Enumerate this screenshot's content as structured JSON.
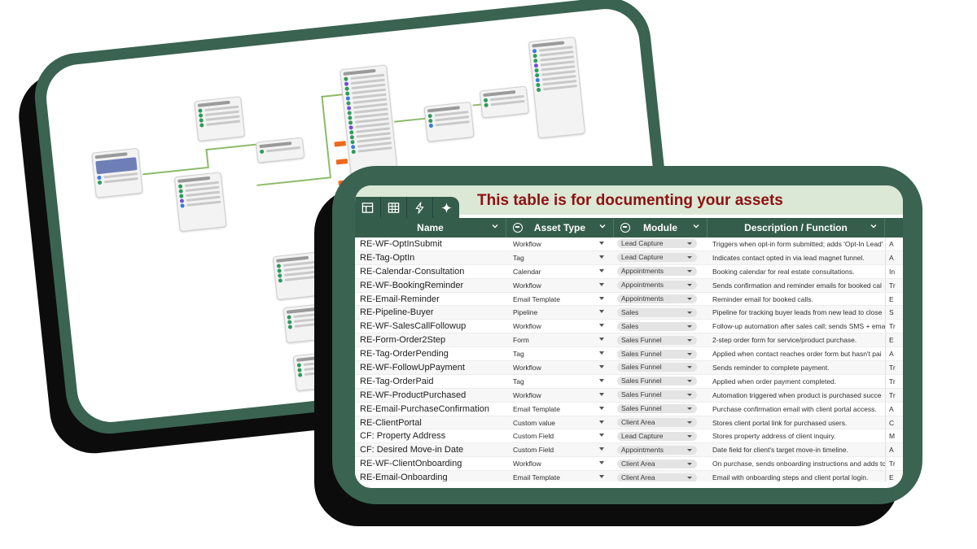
{
  "table": {
    "title": "This table is for documenting your assets",
    "columns": {
      "name": "Name",
      "asset_type": "Asset Type",
      "module": "Module",
      "description": "Description / Function"
    },
    "rows": [
      {
        "name": "RE-WF-OptInSubmit",
        "type": "Workflow",
        "module": "Lead Capture",
        "desc": "Triggers when opt-in form submitted; adds 'Opt-In Lead'",
        "extra": "A"
      },
      {
        "name": "RE-Tag-OptIn",
        "type": "Tag",
        "module": "Lead Capture",
        "desc": "Indicates contact opted in via lead magnet funnel.",
        "extra": "A"
      },
      {
        "name": "RE-Calendar-Consultation",
        "type": "Calendar",
        "module": "Appointments",
        "desc": "Booking calendar for real estate consultations.",
        "extra": "In"
      },
      {
        "name": "RE-WF-BookingReminder",
        "type": "Workflow",
        "module": "Appointments",
        "desc": "Sends confirmation and reminder emails for booked cal",
        "extra": "Tr"
      },
      {
        "name": "RE-Email-Reminder",
        "type": "Email Template",
        "module": "Appointments",
        "desc": "Reminder email for booked calls.",
        "extra": "E"
      },
      {
        "name": "RE-Pipeline-Buyer",
        "type": "Pipeline",
        "module": "Sales",
        "desc": "Pipeline for tracking buyer leads from new lead to close",
        "extra": "S"
      },
      {
        "name": "RE-WF-SalesCallFollowup",
        "type": "Workflow",
        "module": "Sales",
        "desc": "Follow-up automation after sales call; sends SMS + ema",
        "extra": "Tr"
      },
      {
        "name": "RE-Form-Order2Step",
        "type": "Form",
        "module": "Sales Funnel",
        "desc": "2-step order form for service/product purchase.",
        "extra": "E"
      },
      {
        "name": "RE-Tag-OrderPending",
        "type": "Tag",
        "module": "Sales Funnel",
        "desc": "Applied when contact reaches order form but hasn't pai",
        "extra": "A"
      },
      {
        "name": "RE-WF-FollowUpPayment",
        "type": "Workflow",
        "module": "Sales Funnel",
        "desc": "Sends reminder to complete payment.",
        "extra": "Tr"
      },
      {
        "name": "RE-Tag-OrderPaid",
        "type": "Tag",
        "module": "Sales Funnel",
        "desc": "Applied when order payment completed.",
        "extra": "Tr"
      },
      {
        "name": "RE-WF-ProductPurchased",
        "type": "Workflow",
        "module": "Sales Funnel",
        "desc": "Automation triggered when product is purchased succe",
        "extra": "Tr"
      },
      {
        "name": "RE-Email-PurchaseConfirmation",
        "type": "Email Template",
        "module": "Sales Funnel",
        "desc": "Purchase confirmation email with client portal access.",
        "extra": "A"
      },
      {
        "name": "RE-ClientPortal",
        "type": "Custom value",
        "module": "Client Area",
        "desc": "Stores client portal link for purchased users.",
        "extra": "C"
      },
      {
        "name": "CF: Property Address",
        "type": "Custom Field",
        "module": "Lead Capture",
        "desc": "Stores property address of client inquiry.",
        "extra": "M"
      },
      {
        "name": "CF: Desired Move-in Date",
        "type": "Custom Field",
        "module": "Appointments",
        "desc": "Date field for client's target move-in timeline.",
        "extra": "A"
      },
      {
        "name": "RE-WF-ClientOnboarding",
        "type": "Workflow",
        "module": "Client Area",
        "desc": "On purchase, sends onboarding instructions and adds to",
        "extra": "Tr"
      },
      {
        "name": "RE-Email-Onboarding",
        "type": "Email Template",
        "module": "Client Area",
        "desc": "Email with onboarding steps and client portal login.",
        "extra": "E"
      }
    ]
  },
  "toolbar_icons": [
    "table-icon",
    "grid-icon",
    "lightning-icon",
    "sparkle-icon"
  ],
  "colors": {
    "frame_green": "#3a6351",
    "header_green": "#345d4b",
    "title_red": "#8e1111",
    "title_bar": "#dbe8d6"
  }
}
